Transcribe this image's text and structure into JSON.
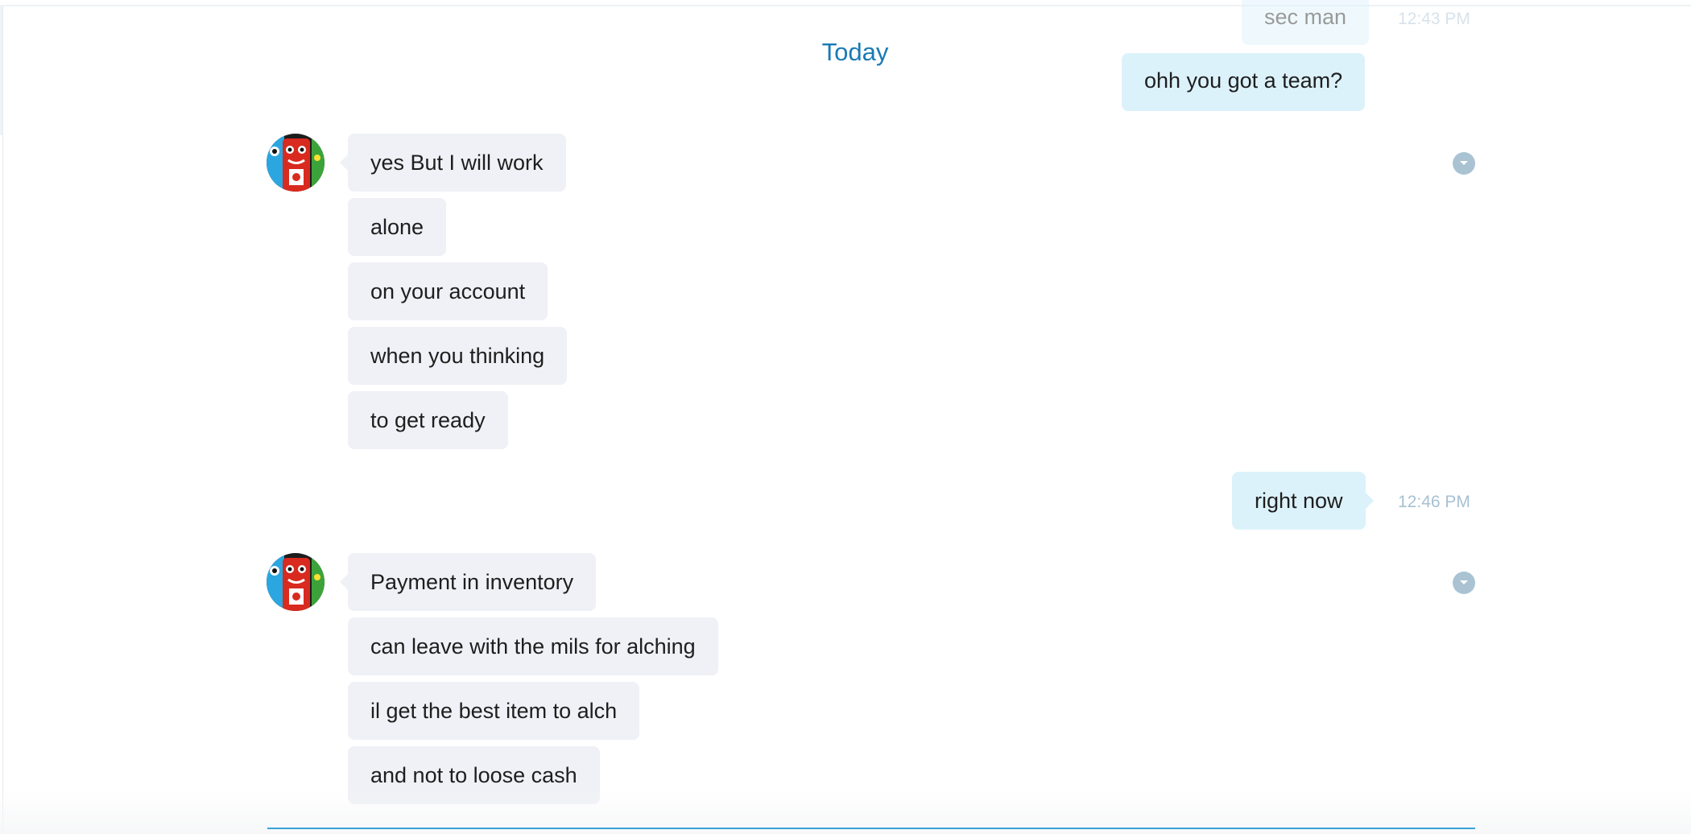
{
  "divider": {
    "label": "Today"
  },
  "conversation": {
    "previous": {
      "faded_text": "sec man",
      "faded_time": "12:43 PM",
      "last_sent_text": "ohh you got a team?"
    },
    "group1": {
      "messages": [
        "yes But I will work",
        "alone",
        "on your account",
        "when you thinking",
        "to get ready"
      ]
    },
    "reply": {
      "text": "right now",
      "time": "12:46 PM"
    },
    "group2": {
      "messages": [
        "Payment in inventory",
        "can leave with the mils for alching",
        "il get the best item to alch",
        "and not to loose cash"
      ]
    }
  },
  "colors": {
    "accent": "#1a7ab5",
    "incoming_bubble": "#eff1f6",
    "outgoing_bubble": "#dcf2fb",
    "timestamp": "#a8c1d3",
    "more_button": "#a9c3d2"
  },
  "icons": {
    "avatar": "monster-avatar-icon",
    "more": "chevron-down-icon"
  }
}
